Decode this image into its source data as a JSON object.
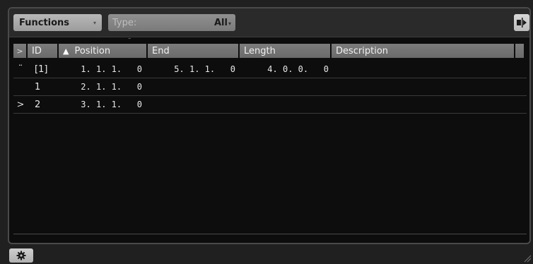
{
  "toolbar": {
    "functions_label": "Functions",
    "type_placeholder": "Type:",
    "type_value": "All"
  },
  "icons": {
    "chevron": "▾",
    "sort_asc": "▲",
    "expand": ">",
    "splitter": "¨"
  },
  "table": {
    "headers": {
      "selector": ">",
      "id": "ID",
      "position": "Position",
      "end": "End",
      "length": "Length",
      "description": "Description"
    },
    "rows": [
      {
        "marker": "¨",
        "id": "[1]",
        "position": "1. 1. 1.   0",
        "end": "5. 1. 1.   0",
        "length": "4. 0. 0.   0",
        "description": ""
      },
      {
        "marker": "",
        "id": "1",
        "position": "2. 1. 1.   0",
        "end": "",
        "length": "",
        "description": ""
      },
      {
        "marker": ">",
        "id": "2",
        "position": "3. 1. 1.   0",
        "end": "",
        "length": "",
        "description": ""
      }
    ]
  }
}
